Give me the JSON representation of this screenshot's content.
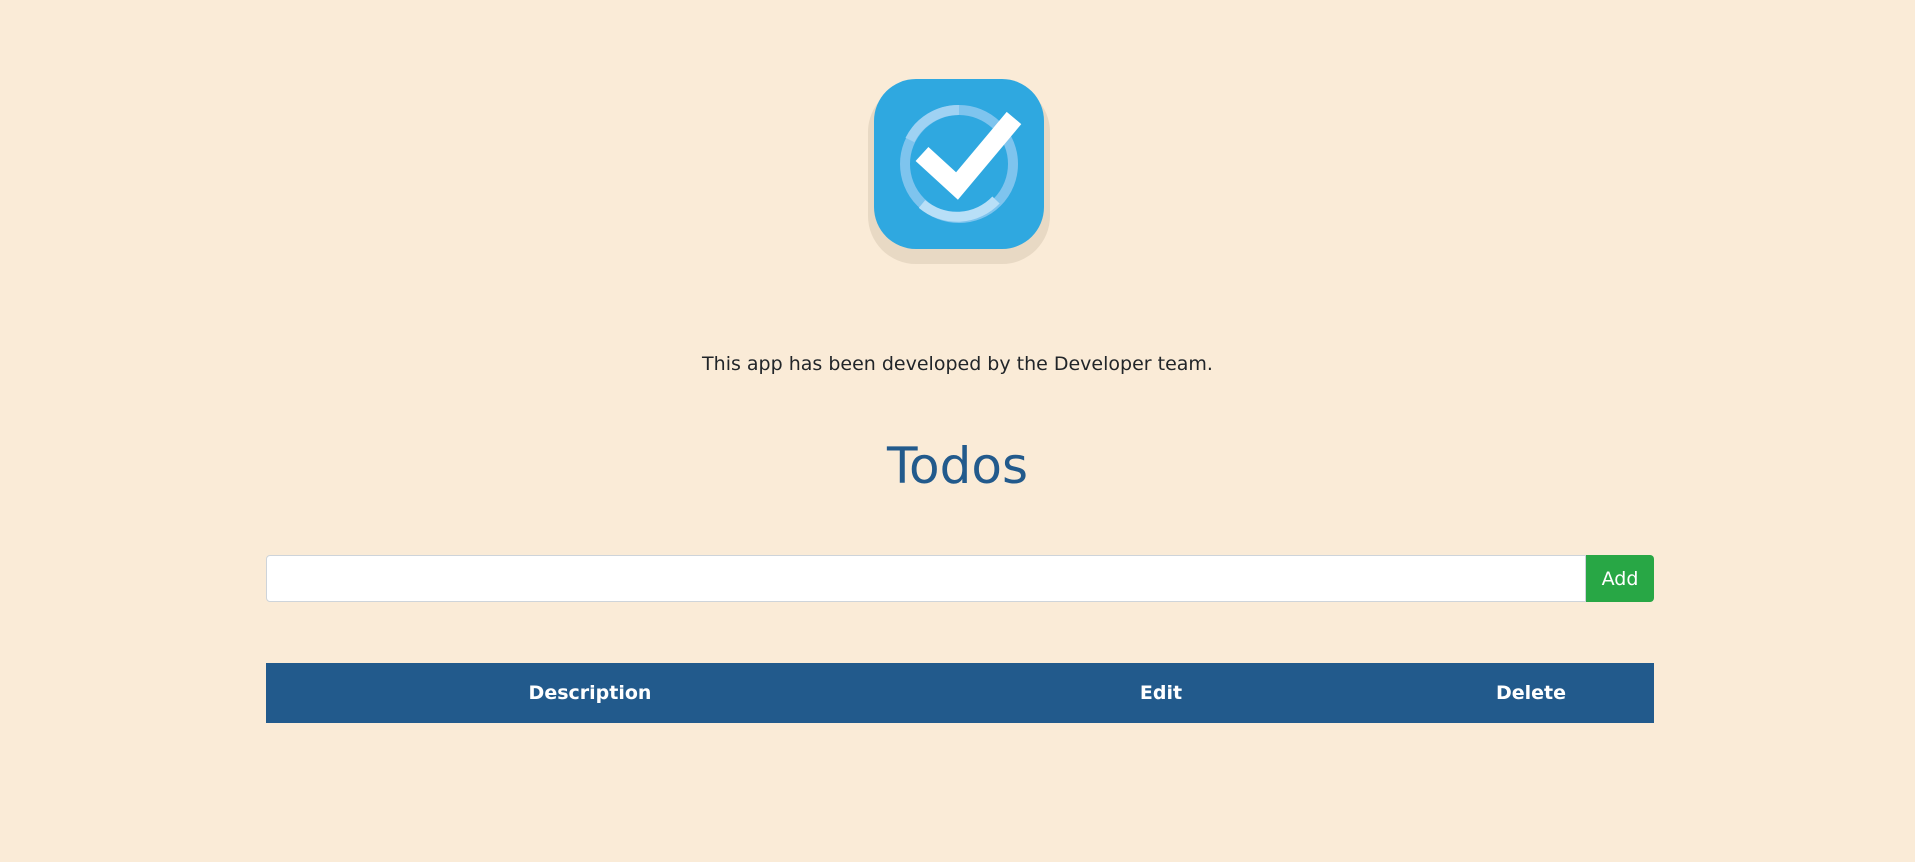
{
  "app": {
    "logo_icon": "checkmark-circle-icon",
    "accent_color": "#2fa8e0"
  },
  "credit_text": "This app has been developed by the Developer team.",
  "title": "Todos",
  "add_form": {
    "input_value": "",
    "add_label": "Add",
    "add_color": "#28a745"
  },
  "table": {
    "header_color": "#225a8c",
    "columns": [
      "Description",
      "Edit",
      "Delete"
    ],
    "rows": []
  }
}
